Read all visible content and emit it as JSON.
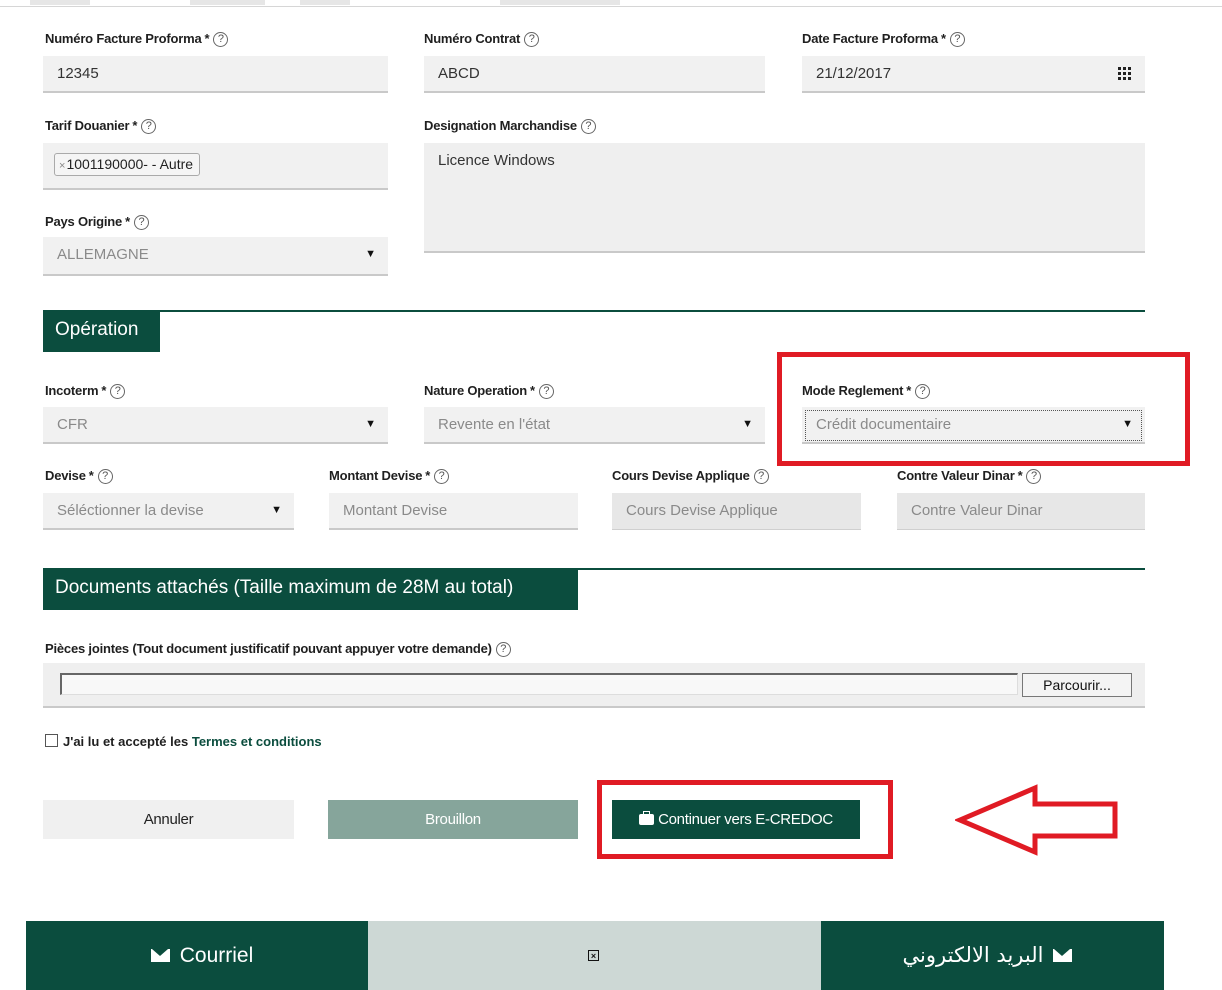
{
  "labels": {
    "numero_facture": "Numéro Facture Proforma",
    "numero_contrat": "Numéro Contrat",
    "date_facture": "Date Facture Proforma",
    "tarif_douanier": "Tarif Douanier",
    "designation": "Designation Marchandise",
    "pays_origine": "Pays Origine",
    "incoterm": "Incoterm",
    "nature_operation": "Nature Operation",
    "mode_reglement": "Mode Reglement",
    "devise": "Devise",
    "montant_devise": "Montant Devise",
    "cours_devise": "Cours Devise Applique",
    "contre_valeur": "Contre Valeur Dinar",
    "pieces_jointes": "Pièces jointes (Tout document justificatif pouvant appuyer votre demande)"
  },
  "required_mark": "*",
  "help_glyph": "?",
  "values": {
    "numero_facture": "12345",
    "numero_contrat": "ABCD",
    "date_facture": "21/12/2017",
    "tarif_tag": "1001190000- - Autre",
    "designation": "Licence Windows",
    "pays_origine": "ALLEMAGNE",
    "incoterm": "CFR",
    "nature_operation": "Revente en l'état",
    "mode_reglement": "Crédit documentaire",
    "devise": "Séléctionner la devise"
  },
  "placeholders": {
    "montant_devise": "Montant Devise",
    "cours_devise": "Cours Devise Applique",
    "contre_valeur": "Contre Valeur Dinar"
  },
  "sections": {
    "operation": "Opération",
    "documents": "Documents attachés (Taille maximum de 28M au total)"
  },
  "file": {
    "browse_label": "Parcourir..."
  },
  "terms": {
    "prefix": "J'ai lu et accepté les",
    "link": "Termes et conditions"
  },
  "buttons": {
    "annuler": "Annuler",
    "brouillon": "Brouillon",
    "continuer": "Continuer vers E-CREDOC"
  },
  "footer": {
    "left": "Courriel",
    "right": "البريد الالكتروني"
  },
  "icons": {
    "calendar": "calendar-grid-icon",
    "help": "help-circle-icon",
    "envelope": "envelope-icon",
    "briefcase": "briefcase-icon",
    "close_box": "close-box-icon"
  },
  "colors": {
    "brand_green": "#0b4d3e",
    "draft_button": "#86a59b",
    "annotation_red": "#e01b24"
  }
}
